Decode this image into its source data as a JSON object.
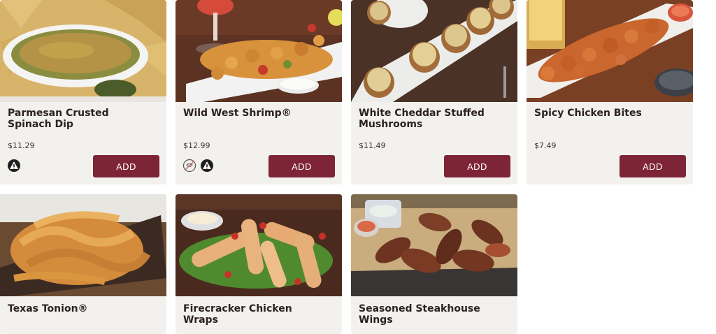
{
  "menu": {
    "items": [
      {
        "name": "Parmesan Crusted Spinach Dip",
        "price": "$11.29",
        "add_label": "ADD",
        "icons": [
          "warning-icon"
        ]
      },
      {
        "name": "Wild West Shrimp®",
        "price": "$12.99",
        "add_label": "ADD",
        "icons": [
          "no-peppers-icon",
          "warning-icon"
        ]
      },
      {
        "name": "White Cheddar Stuffed Mushrooms",
        "price": "$11.49",
        "add_label": "ADD",
        "icons": []
      },
      {
        "name": "Spicy Chicken Bites",
        "price": "$7.49",
        "add_label": "ADD",
        "icons": []
      },
      {
        "name": "Texas Tonion®"
      },
      {
        "name": "Firecracker Chicken Wraps"
      },
      {
        "name": "Seasoned Steakhouse Wings"
      }
    ]
  },
  "colors": {
    "button": "#7d2437",
    "card_background": "#f3f1ee",
    "text": "#2b2220"
  }
}
